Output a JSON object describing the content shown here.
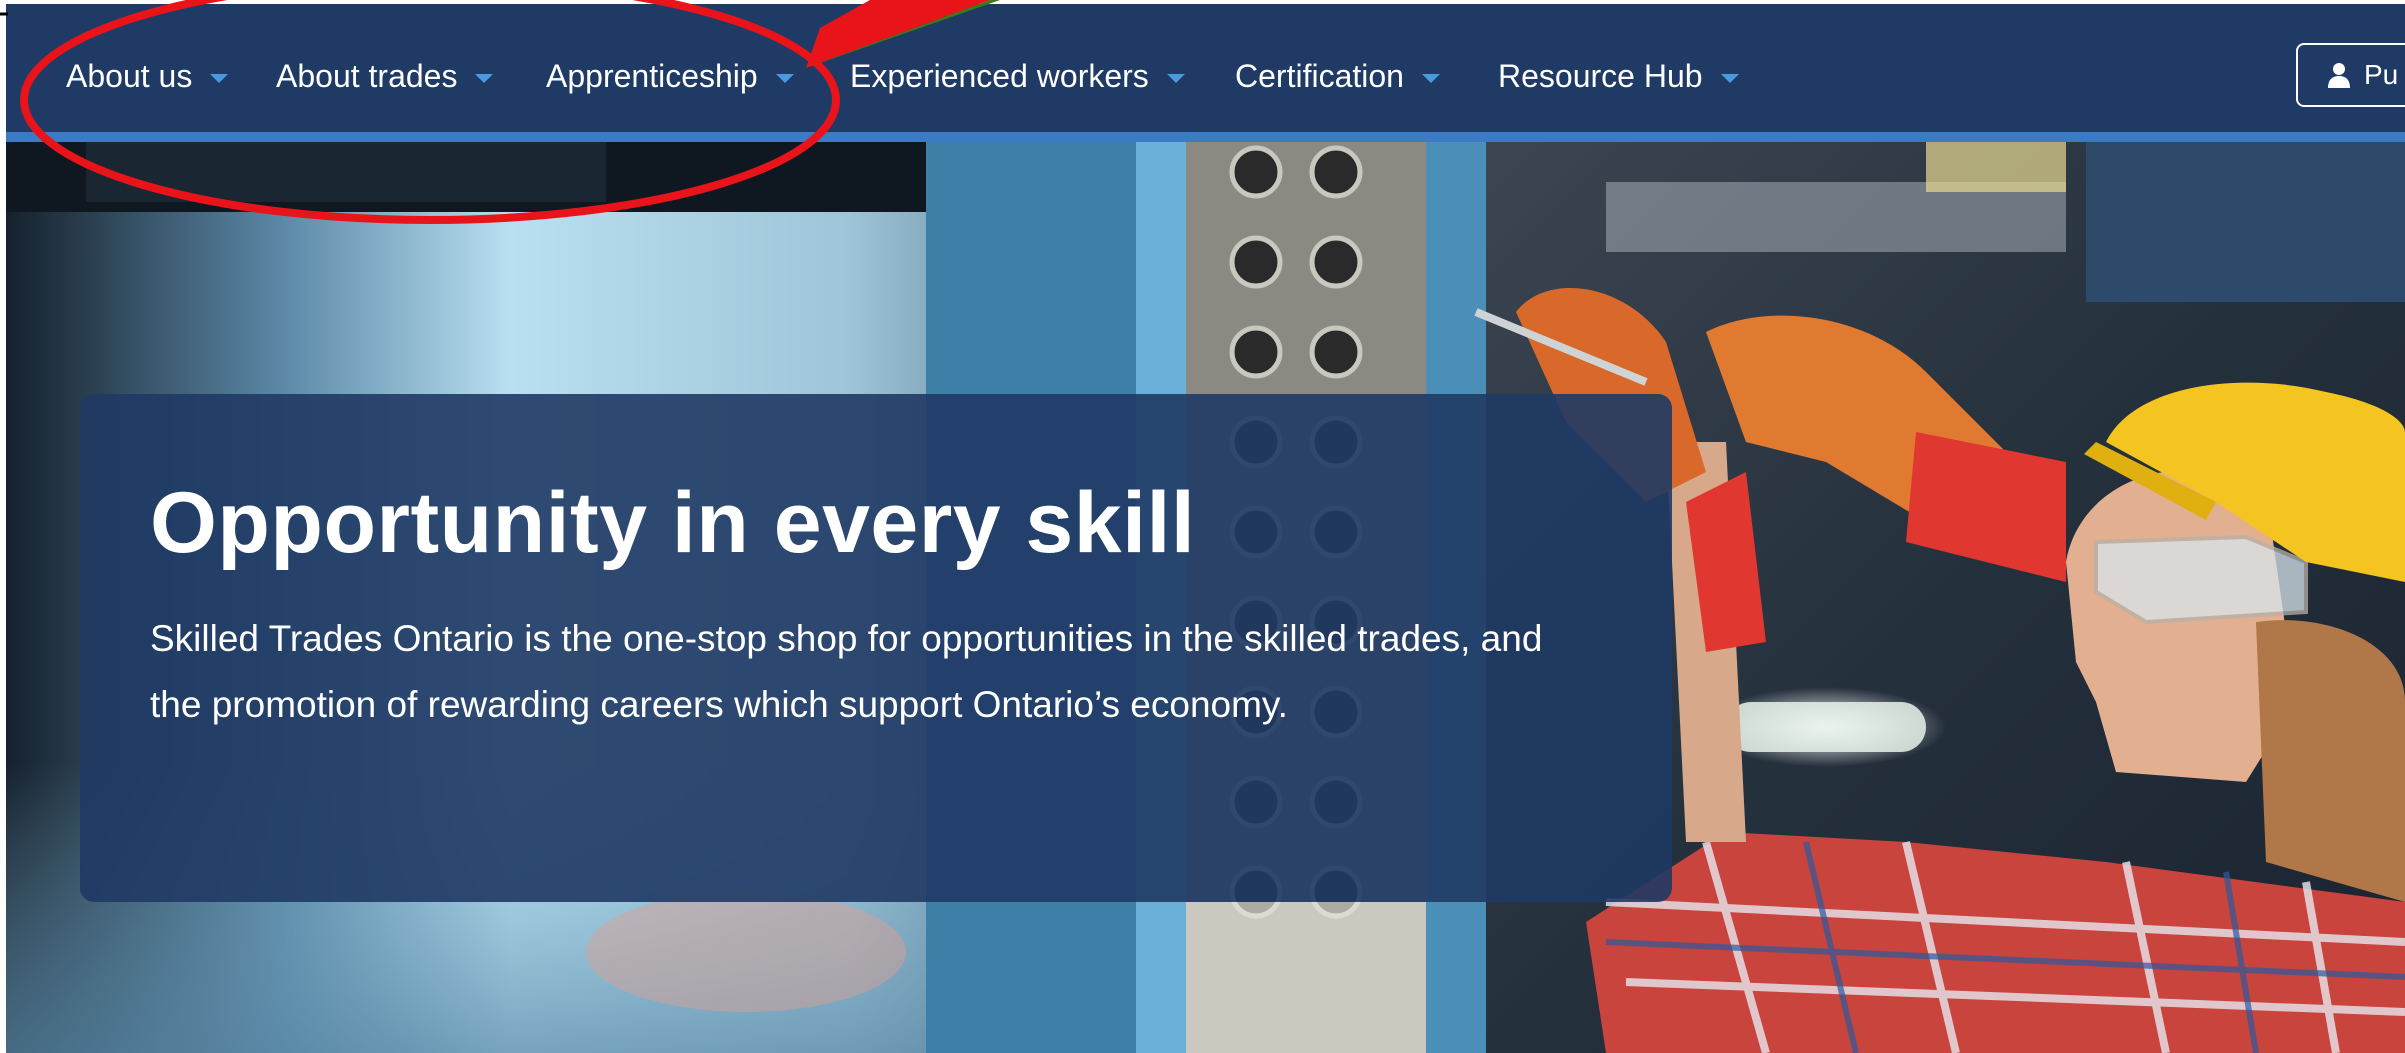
{
  "nav": {
    "items": [
      {
        "label": "About us"
      },
      {
        "label": "About trades"
      },
      {
        "label": "Apprenticeship"
      },
      {
        "label": "Experienced workers"
      },
      {
        "label": "Certification"
      },
      {
        "label": "Resource Hub"
      }
    ],
    "portal_button": {
      "label": "Pu",
      "icon": "user-icon"
    }
  },
  "hero": {
    "title": "Opportunity in every skill",
    "text": "Skilled Trades Ontario is the one-stop shop for opportunities in the skilled trades, and the promotion of rewarding careers which support Ontario’s economy."
  },
  "colors": {
    "nav_bg": "#1f3a64",
    "nav_underline": "#3d7ac4",
    "caret": "#4a9ae0",
    "annotation": "#e8141a"
  }
}
